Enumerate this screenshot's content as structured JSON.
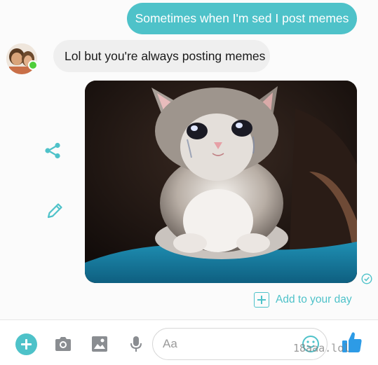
{
  "conversation": {
    "outgoing_message": "Sometimes when I'm sed I post memes",
    "incoming_message": "Lol but you're always posting memes",
    "contact": {
      "online": true,
      "avatar": "contact-avatar"
    },
    "shared_photo": {
      "subject": "crying-kitten-meme",
      "sender": "me"
    },
    "seen_status": "seen"
  },
  "actions": {
    "share_icon": "share-icon",
    "edit_icon": "pencil-icon",
    "add_to_day_label": "Add to your day"
  },
  "composer": {
    "placeholder": "Aa",
    "value": "",
    "buttons": [
      "plus-icon",
      "camera-icon",
      "image-icon",
      "microphone-icon",
      "emoji-icon",
      "thumbs-up-icon"
    ]
  },
  "watermark": "18aaa.lol",
  "colors": {
    "accent": "#4ec2c9",
    "incoming_bubble": "#efefef",
    "online": "#4fce3b",
    "like": "#2d9be6"
  }
}
